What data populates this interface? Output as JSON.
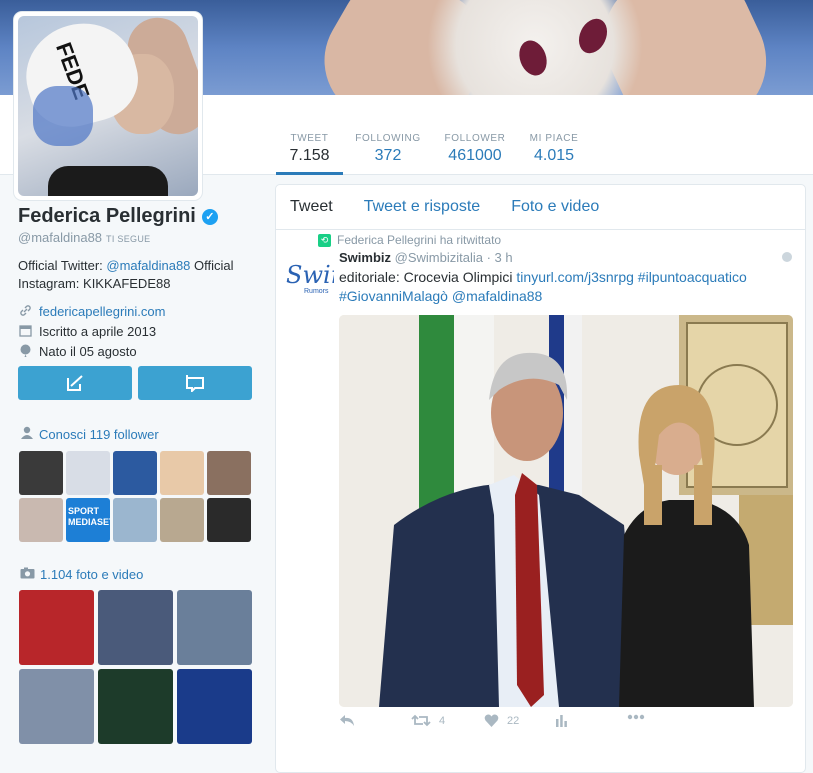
{
  "profile": {
    "name": "Federica Pellegrini",
    "handle": "@mafaldina88",
    "follows_you": "TI SEGUE",
    "bio_prefix": "Official Twitter: ",
    "bio_link": "@mafaldina88",
    "bio_suffix": " Official Instagram: KIKKAFEDE88",
    "website": "federicapellegrini.com",
    "joined": "Iscritto a aprile 2013",
    "birthday": "Nato il 05 agosto",
    "avatar_text": "FEDE"
  },
  "stats": [
    {
      "label": "TWEET",
      "value": "7.158"
    },
    {
      "label": "FOLLOWING",
      "value": "372"
    },
    {
      "label": "FOLLOWER",
      "value": "461000"
    },
    {
      "label": "MI PIACE",
      "value": "4.015"
    }
  ],
  "followers_section": {
    "title": "Conosci 119 follower"
  },
  "media_section": {
    "title": "1.104 foto e video"
  },
  "follower_thumbs": [
    {
      "bg": "#3a3a3a",
      "badge": ""
    },
    {
      "bg": "#d8dde6",
      "badge": ""
    },
    {
      "bg": "#2c5aa0",
      "badge": ""
    },
    {
      "bg": "#e8c9a8",
      "badge": ""
    },
    {
      "bg": "#8a7060",
      "badge": ""
    },
    {
      "bg": "#c9b9b0",
      "badge": ""
    },
    {
      "bg": "#1d7fd6",
      "badge": "SPORT MEDIASET"
    },
    {
      "bg": "#9bb6cf",
      "badge": ""
    },
    {
      "bg": "#b8a890",
      "badge": ""
    },
    {
      "bg": "#2a2a2a",
      "badge": ""
    }
  ],
  "media_thumbs": [
    {
      "bg": "#b8262a"
    },
    {
      "bg": "#4a5a7a"
    },
    {
      "bg": "#6a7f9a"
    },
    {
      "bg": "#8090a8"
    },
    {
      "bg": "#1d3b2a"
    },
    {
      "bg": "#1a3b8a"
    }
  ],
  "tabs": [
    {
      "label": "Tweet"
    },
    {
      "label": "Tweet e risposte"
    },
    {
      "label": "Foto e video"
    }
  ],
  "tweet": {
    "retweet_notice": "Federica Pellegrini ha ritwittato",
    "author_name": "Swimbiz",
    "author_handle": "@Swimbizitalia",
    "separator": " · ",
    "time": "3 h",
    "avatar_text": "Swir",
    "avatar_sub": "Rumors",
    "text_prefix": "editoriale: Crocevia Olimpici ",
    "link_url": "tinyurl.com/j3snrpg",
    "hashtag1": "#ilpuntoacquatico",
    "hashtag2": "#GiovanniMalagò",
    "mention": "@mafaldina88",
    "retweets": "4",
    "likes": "22"
  },
  "icons": {
    "reply": "reply-icon",
    "retweet": "retweet-icon",
    "like": "heart-icon",
    "analytics": "analytics-icon",
    "more": "more-icon"
  },
  "colors": {
    "link": "#2b7bb9",
    "button": "#3ca2d1",
    "verified": "#1da1f2",
    "retweet_green": "#19cf86"
  }
}
